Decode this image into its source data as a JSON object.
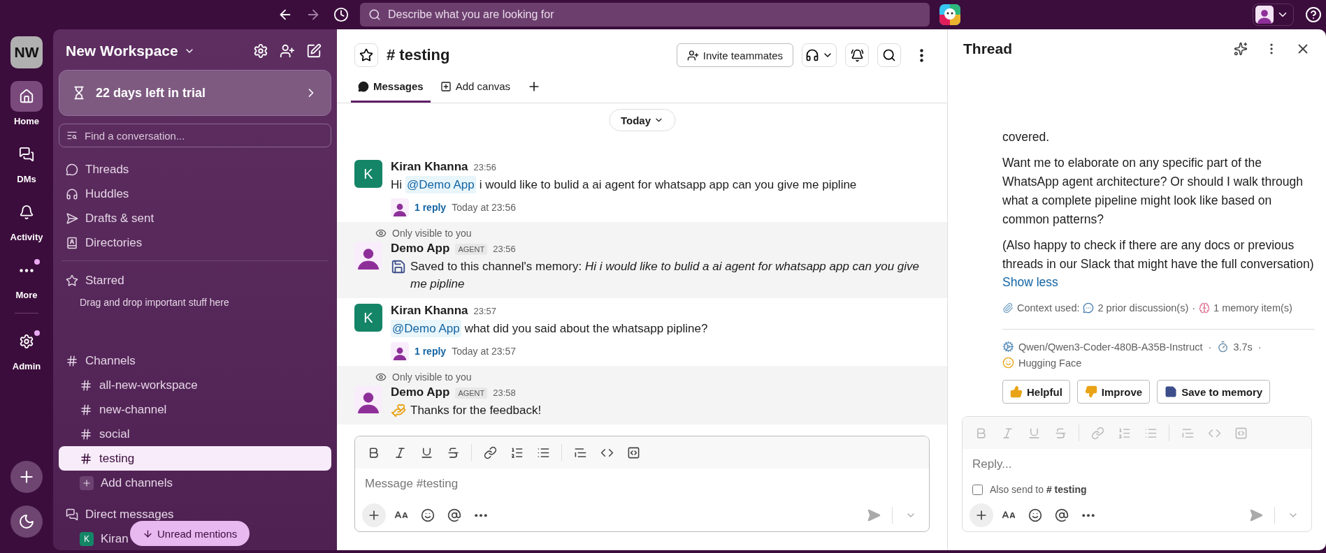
{
  "top_bar": {
    "search": {
      "placeholder": "Describe what you are looking for"
    }
  },
  "rail": {
    "workspace_initials": "NW",
    "items": [
      {
        "label": "Home",
        "selected": true,
        "badge": false
      },
      {
        "label": "DMs",
        "selected": false,
        "badge": false
      },
      {
        "label": "Activity",
        "selected": false,
        "badge": false
      },
      {
        "label": "More",
        "selected": false,
        "badge": true
      },
      {
        "label": "Admin",
        "selected": false,
        "badge": true
      }
    ]
  },
  "sidebar": {
    "workspace": "New Workspace",
    "trial": "22 days left in trial",
    "search": {
      "placeholder": "Find a conversation..."
    },
    "nav": [
      {
        "label": "Threads"
      },
      {
        "label": "Huddles"
      },
      {
        "label": "Drafts & sent"
      },
      {
        "label": "Directories"
      }
    ],
    "starred": {
      "title": "Starred",
      "hint": "Drag and drop important stuff here"
    },
    "channels": {
      "title": "Channels",
      "items": [
        {
          "name": "all-new-workspace",
          "selected": false
        },
        {
          "name": "new-channel",
          "selected": false
        },
        {
          "name": "social",
          "selected": false
        },
        {
          "name": "testing",
          "selected": true
        }
      ],
      "add": "Add channels"
    },
    "direct_messages": {
      "title": "Direct messages",
      "items": [
        {
          "initial": "K",
          "name": "Kiran"
        }
      ]
    },
    "unread_button": "Unread mentions"
  },
  "channel": {
    "title": "# testing",
    "invite": "Invite teammates",
    "tabs": [
      {
        "label": "Messages",
        "selected": true
      },
      {
        "label": "Add canvas",
        "selected": false
      }
    ],
    "date_divider": "Today",
    "messages": [
      {
        "kind": "user",
        "author": "Kiran Khanna",
        "initial": "K",
        "time": "23:56",
        "parts": [
          {
            "kind": "text",
            "text": "Hi"
          },
          {
            "kind": "mention",
            "text": "@Demo App"
          },
          {
            "kind": "text",
            "text": "i would like to bulid a ai agent for whatsapp app can you give me pipline"
          }
        ],
        "replies": "1 reply",
        "reply_time": "Today at 23:56"
      },
      {
        "kind": "saved",
        "visibility": "Only visible to you",
        "author": "Demo App",
        "badge": "AGENT",
        "time": "23:56",
        "body": "Saved to this channel's memory: *Hi i would like to bulid a ai agent for whatsapp app can you give me pipline*"
      },
      {
        "kind": "user",
        "author": "Kiran Khanna",
        "initial": "K",
        "time": "23:57",
        "parts": [
          {
            "kind": "mention",
            "text": "@Demo App"
          },
          {
            "kind": "text",
            "text": "what did you said about the whatsapp pipline?"
          }
        ],
        "replies": "1 reply",
        "reply_time": "Today at 23:57"
      },
      {
        "kind": "thanks",
        "visibility": "Only visible to you",
        "author": "Demo App",
        "badge": "AGENT",
        "time": "23:58",
        "body": "Thanks for the feedback!"
      }
    ],
    "composer": {
      "placeholder": "Message #testing"
    }
  },
  "thread": {
    "title": "Thread",
    "paragraphs": [
      "covered.",
      "Want me to elaborate on any specific part of the WhatsApp agent architecture? Or should I walk through what a complete pipeline might look like based on common patterns?",
      "(Also happy to check if there are any docs or previous threads in our Slack that might have the full conversation)"
    ],
    "show_less": "Show less",
    "context": {
      "label": "Context used:",
      "discussions": "2 prior discussion(s)",
      "memory": "1 memory item(s)"
    },
    "separator": "·",
    "meta": [
      {
        "kind": "model",
        "text": "Qwen/Qwen3-Coder-480B-A35B-Instruct"
      },
      {
        "kind": "timer",
        "text": "3.7s"
      },
      {
        "kind": "provider",
        "text": "Hugging Face"
      }
    ],
    "actions": [
      {
        "kind": "helpful",
        "label": "Helpful"
      },
      {
        "kind": "improve",
        "label": "Improve"
      },
      {
        "kind": "save",
        "label": "Save to memory"
      }
    ],
    "composer": {
      "placeholder": "Reply...",
      "also_send": "Also send to **# testing**",
      "also_send_checked": false
    }
  }
}
